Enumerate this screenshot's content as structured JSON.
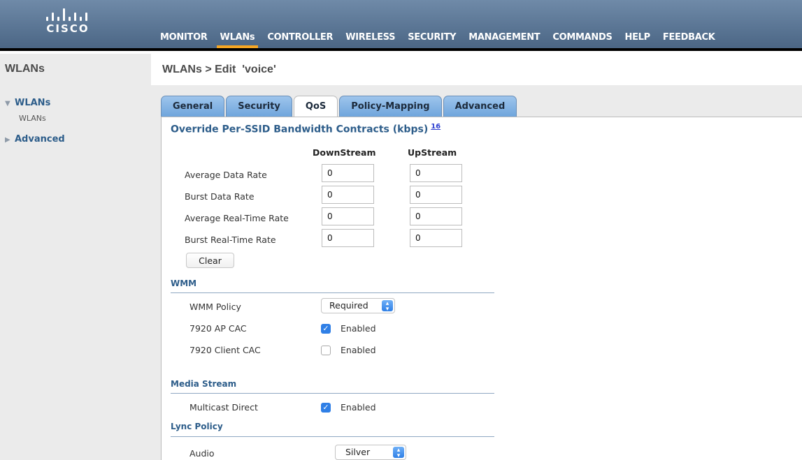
{
  "brand": {
    "logo_text": "CISCO"
  },
  "nav": [
    {
      "label": "MONITOR",
      "active": false
    },
    {
      "label": "WLANs",
      "active": true
    },
    {
      "label": "CONTROLLER",
      "active": false
    },
    {
      "label": "WIRELESS",
      "active": false
    },
    {
      "label": "SECURITY",
      "active": false
    },
    {
      "label": "MANAGEMENT",
      "active": false
    },
    {
      "label": "COMMANDS",
      "active": false
    },
    {
      "label": "HELP",
      "active": false
    },
    {
      "label": "FEEDBACK",
      "active": false
    }
  ],
  "sidebar": {
    "title": "WLANs",
    "section_wlans": "WLANs",
    "sub_wlans": "WLANs",
    "section_advanced": "Advanced"
  },
  "header": {
    "title": "WLANs > Edit  'voice'"
  },
  "tabs": [
    {
      "label": "General",
      "active": false
    },
    {
      "label": "Security",
      "active": false
    },
    {
      "label": "QoS",
      "active": true
    },
    {
      "label": "Policy-Mapping",
      "active": false
    },
    {
      "label": "Advanced",
      "active": false
    }
  ],
  "bandwidth": {
    "title": "Override Per-SSID Bandwidth Contracts (kbps)",
    "footnote": "16",
    "col_down": "DownStream",
    "col_up": "UpStream",
    "rows": [
      {
        "label": "Average Data Rate",
        "down": "0",
        "up": "0"
      },
      {
        "label": "Burst Data Rate",
        "down": "0",
        "up": "0"
      },
      {
        "label": "Average Real-Time Rate",
        "down": "0",
        "up": "0"
      },
      {
        "label": "Burst Real-Time Rate",
        "down": "0",
        "up": "0"
      }
    ],
    "clear_label": "Clear"
  },
  "wmm": {
    "title": "WMM",
    "policy_label": "WMM Policy",
    "policy_value": "Required",
    "ap_cac_label": "7920 AP CAC",
    "ap_cac_checked": true,
    "ap_cac_text": "Enabled",
    "client_cac_label": "7920 Client CAC",
    "client_cac_checked": false,
    "client_cac_text": "Enabled"
  },
  "media_stream": {
    "title": "Media Stream",
    "multicast_label": "Multicast Direct",
    "multicast_checked": true,
    "multicast_text": "Enabled"
  },
  "lync": {
    "title": "Lync Policy",
    "audio_label": "Audio",
    "audio_value": "Silver"
  },
  "colors": {
    "accent": "#f5a623",
    "link": "#2d5d8a",
    "checkbox": "#2f7fe6"
  }
}
